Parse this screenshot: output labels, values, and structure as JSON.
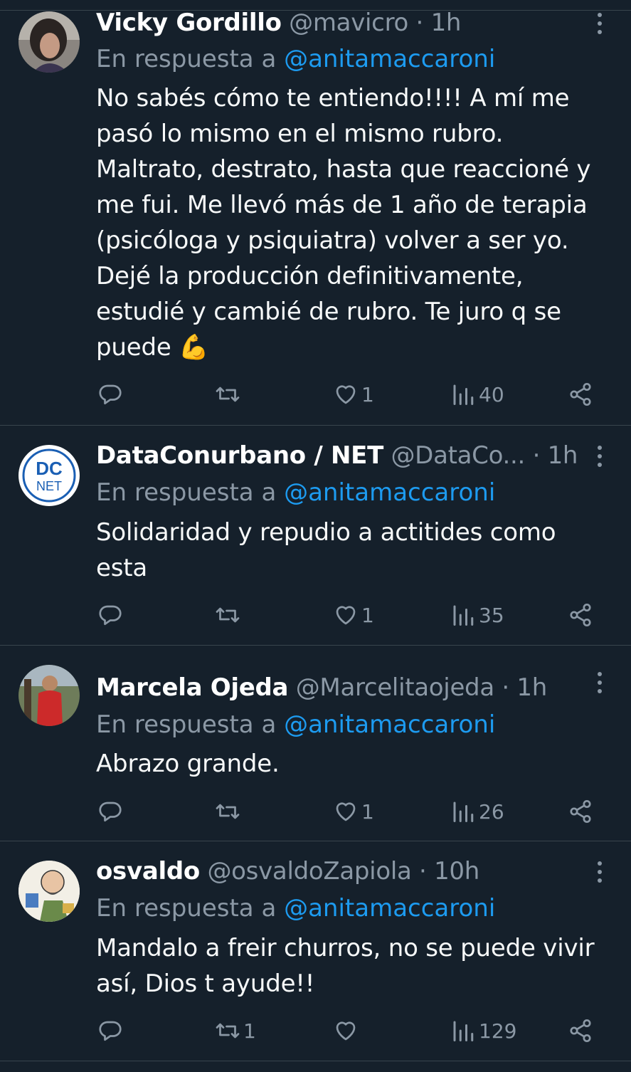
{
  "colors": {
    "background": "#15202b",
    "divider": "#38444d",
    "secondary_text": "#8b98a5",
    "link": "#1d9bf0"
  },
  "tweets": [
    {
      "name": "Vicky Gordillo",
      "handle": "@mavicro",
      "dot": "·",
      "time": "1h",
      "reply_prefix": "En respuesta a",
      "reply_to": "@anitamaccaroni",
      "text_lines": [
        "No sabés cómo te entiendo!!!! A mí me",
        "pasó lo mismo en el mismo rubro.",
        "Maltrato, destrato, hasta que reaccioné y",
        "me fui. Me llevó más de 1 año de terapia",
        "(psicóloga y psiquiatra) volver a ser yo.",
        "Dejé la producción definitivamente,",
        "estudié y cambié de rubro. Te juro q se",
        "puede 💪"
      ],
      "replies": "",
      "retweets": "",
      "likes": "1",
      "views": "40",
      "avatar_icon": "avatar-photo-woman"
    },
    {
      "name": "DataConurbano / NET",
      "handle": "@DataCo...",
      "dot": "·",
      "time": "1h",
      "reply_prefix": "En respuesta a",
      "reply_to": "@anitamaccaroni",
      "text_lines": [
        "Solidaridad y repudio a actitides como",
        "esta"
      ],
      "replies": "",
      "retweets": "",
      "likes": "1",
      "views": "35",
      "avatar_logo_top": "DC",
      "avatar_logo_bottom": "NET"
    },
    {
      "name": "Marcela Ojeda",
      "handle": "@Marcelitaojeda",
      "dot": "·",
      "time": "1h",
      "reply_prefix": "En respuesta a",
      "reply_to": "@anitamaccaroni",
      "text_lines": [
        "Abrazo grande."
      ],
      "replies": "",
      "retweets": "",
      "likes": "1",
      "views": "26",
      "avatar_icon": "avatar-photo-woman-red"
    },
    {
      "name": "osvaldo",
      "handle": "@osvaldoZapiola",
      "dot": "·",
      "time": "10h",
      "reply_prefix": "En respuesta a",
      "reply_to": "@anitamaccaroni",
      "text_lines": [
        "Mandalo a freir churros, no se puede vivir",
        "así, Dios t ayude!!"
      ],
      "replies": "",
      "retweets": "1",
      "likes": "",
      "views": "129",
      "avatar_icon": "avatar-cartoon"
    }
  ],
  "icons": {
    "reply": "reply-icon",
    "retweet": "retweet-icon",
    "like": "heart-icon",
    "views": "views-icon",
    "share": "share-icon",
    "more": "more-vertical-icon"
  }
}
